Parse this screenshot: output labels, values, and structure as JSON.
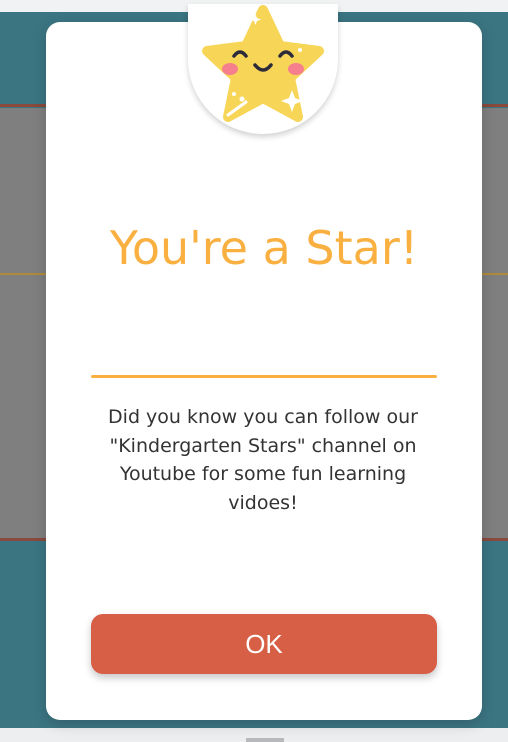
{
  "modal": {
    "title": "You're a Star!",
    "message": "Did you know you can follow our \"Kindergarten Stars\" channel on Youtube for some fun learning vidoes!",
    "ok_label": "OK",
    "badge_icon": "smiling-star-icon"
  },
  "colors": {
    "accent": "#f9b040",
    "button": "#d65f45",
    "backdrop": "#3b7582",
    "overlay": "#7f7f7f"
  }
}
